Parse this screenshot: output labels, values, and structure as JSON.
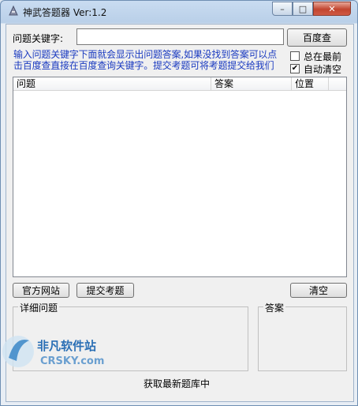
{
  "window": {
    "title": "神武答题器 Ver:1.2"
  },
  "controls": {
    "minimize": "–",
    "maximize": "□",
    "close": "✕"
  },
  "search": {
    "label": "问题关键字:",
    "value": "",
    "button": "百度查"
  },
  "hint": "输入问题关键字下面就会显示出问题答案,如果没找到答案可以点击百度查直接在百度查询关键字。提交考题可将考题提交给我们",
  "options": [
    {
      "label": "总在最前",
      "checked": false
    },
    {
      "label": "自动清空",
      "checked": true
    }
  ],
  "list": {
    "columns": [
      "问题",
      "答案",
      "位置"
    ],
    "rows": []
  },
  "buttons": {
    "official_site": "官方网站",
    "submit_question": "提交考题",
    "clear": "清空"
  },
  "groups": {
    "detail": "详细问题",
    "answer": "答案"
  },
  "status": "获取最新题库中",
  "watermark": {
    "brand": "非凡软件站",
    "site": "CRSKY.com"
  },
  "colors": {
    "hint": "#1a3ac0",
    "title_bg": "#c9dcf1",
    "close": "#c2452f"
  }
}
